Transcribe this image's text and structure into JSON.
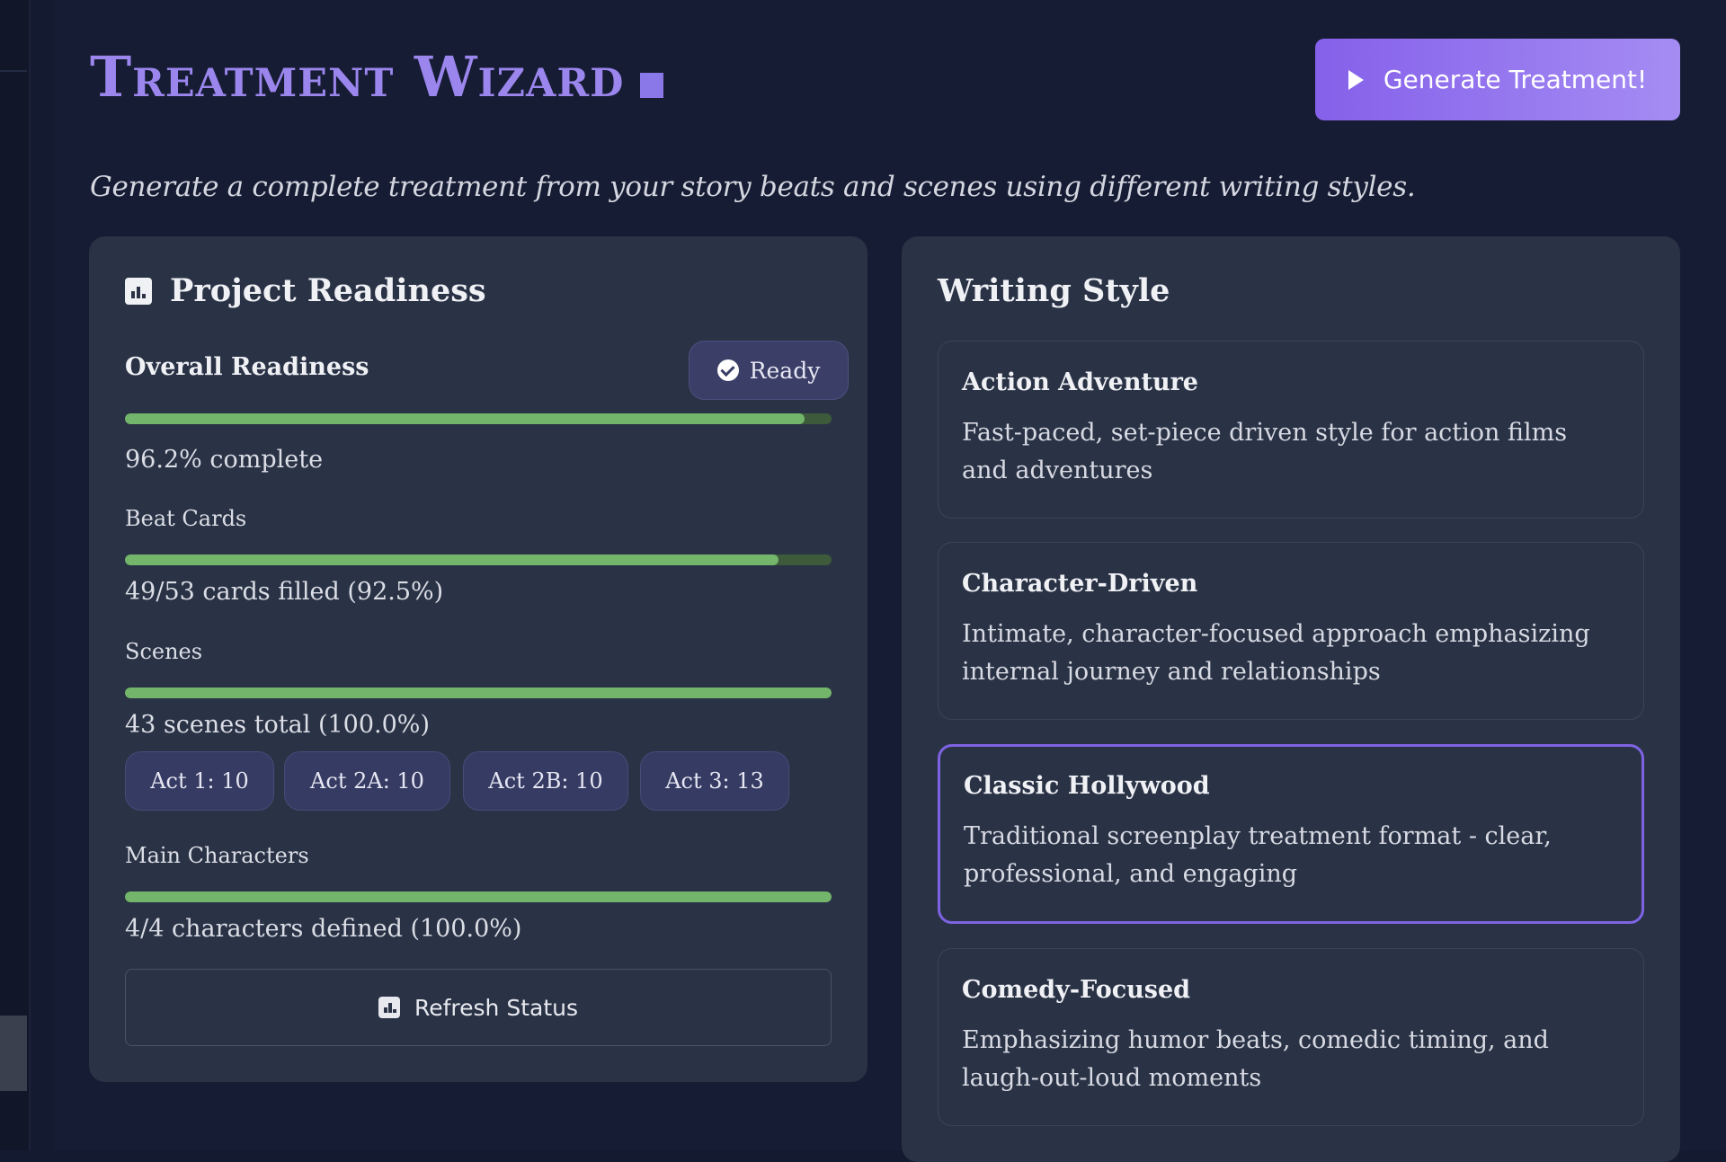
{
  "header": {
    "title": "Treatment Wizard",
    "generate_label": "Generate Treatment!",
    "subtitle": "Generate a complete treatment from your story beats and scenes using different writing styles."
  },
  "readiness": {
    "heading": "Project Readiness",
    "overall_label": "Overall Readiness",
    "status": "Ready",
    "overall_percent": 96.2,
    "overall_text": "96.2% complete",
    "beat_cards": {
      "label": "Beat Cards",
      "percent": 92.5,
      "text": "49/53 cards filled (92.5%)"
    },
    "scenes": {
      "label": "Scenes",
      "percent": 100.0,
      "text": "43 scenes total (100.0%)"
    },
    "acts": [
      "Act 1: 10",
      "Act 2A: 10",
      "Act 2B: 10",
      "Act 3: 13"
    ],
    "characters": {
      "label": "Main Characters",
      "percent": 100.0,
      "text": "4/4 characters defined (100.0%)"
    },
    "refresh_label": "Refresh Status"
  },
  "writing_style": {
    "heading": "Writing Style",
    "selected_index": 2,
    "options": [
      {
        "title": "Action Adventure",
        "description": "Fast-paced, set-piece driven style for action films and adventures"
      },
      {
        "title": "Character-Driven",
        "description": "Intimate, character-focused approach emphasizing internal journey and relationships"
      },
      {
        "title": "Classic Hollywood",
        "description": "Traditional screenplay treatment format - clear, professional, and engaging"
      },
      {
        "title": "Comedy-Focused",
        "description": "Emphasizing humor beats, comedic timing, and laugh-out-loud moments"
      }
    ]
  },
  "colors": {
    "accent": "#8560ea",
    "progress": "#74b56c",
    "panel": "#2a3346"
  },
  "icons": {
    "generate": "play-icon",
    "heading": "bar-chart-icon",
    "status": "check-circle-icon",
    "refresh": "bar-chart-icon"
  }
}
